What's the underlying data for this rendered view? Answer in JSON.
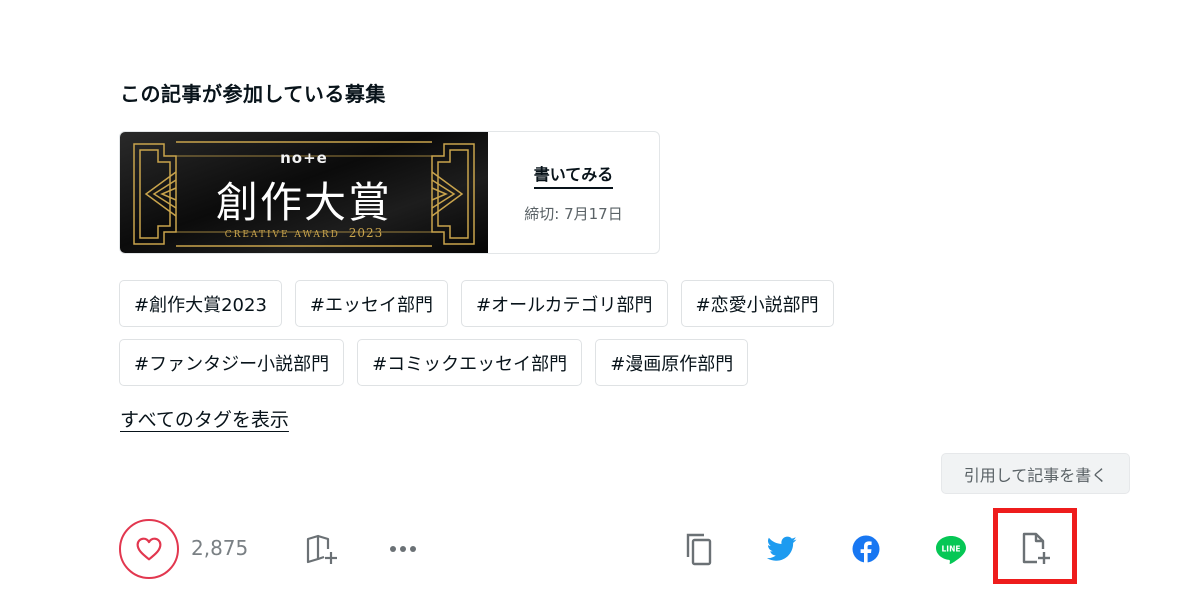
{
  "section_title": "この記事が参加している募集",
  "contest": {
    "brand": "no+e",
    "award_title": "創作大賞",
    "award_sub": "CREATIVE AWARD",
    "award_year": "2023",
    "write_label": "書いてみる",
    "deadline": "締切: 7月17日"
  },
  "tags": [
    [
      "#創作大賞2023",
      "#エッセイ部門",
      "#オールカテゴリ部門",
      "#恋愛小説部門"
    ],
    [
      "#ファンタジー小説部門",
      "#コミックエッセイ部門",
      "#漫画原作部門"
    ]
  ],
  "show_all_tags": "すべてのタグを表示",
  "quote_tooltip": "引用して記事を書く",
  "like_count": "2,875",
  "icons": {
    "like": "heart-icon",
    "magazine": "magazine-add-icon",
    "more": "more-dots-icon",
    "copy": "copy-icon",
    "twitter": "twitter-icon",
    "facebook": "facebook-icon",
    "line": "line-icon",
    "quote": "note-add-icon"
  },
  "colors": {
    "like_red": "#e2374f",
    "twitter_blue": "#1d9bf0",
    "facebook_blue": "#1877f2",
    "line_green": "#06c755",
    "highlight_red": "#ee1c1c",
    "gold": "#c9a44c"
  },
  "line_label": "LINE"
}
